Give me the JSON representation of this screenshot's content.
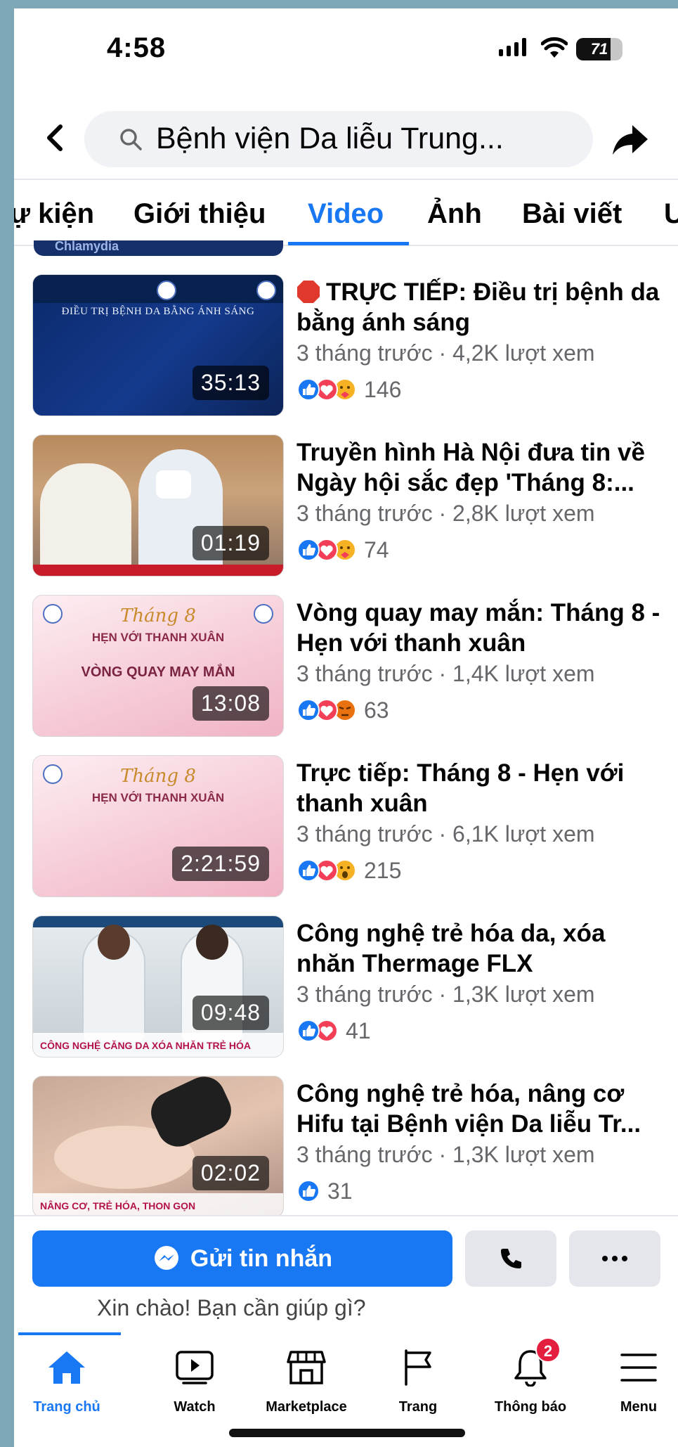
{
  "status_bar": {
    "time": "4:58",
    "battery": "71"
  },
  "search": {
    "query": "Bệnh viện Da liễu Trung..."
  },
  "tabs": [
    {
      "label": "ự kiện"
    },
    {
      "label": "Giới thiệu"
    },
    {
      "label": "Video",
      "active": true
    },
    {
      "label": "Ảnh"
    },
    {
      "label": "Bài viết"
    },
    {
      "label": "U"
    }
  ],
  "peek_label": "Chlamydia",
  "videos": [
    {
      "title": "TRỰC TIẾP: Điều trị bệnh da bằng ánh sáng",
      "live_icon": true,
      "meta": "3 tháng trước · 4,2K lượt xem",
      "reactions": [
        "like",
        "love",
        "care"
      ],
      "count": "146",
      "duration": "35:13",
      "thumb": {
        "caption": "ĐIỀU TRỊ BỆNH DA BẰNG ÁNH SÁNG"
      }
    },
    {
      "title": "Truyền hình Hà Nội đưa tin về Ngày hội sắc đẹp 'Tháng 8:...",
      "meta": "3 tháng trước · 2,8K lượt xem",
      "reactions": [
        "love",
        "care"
      ],
      "count": "74",
      "duration": "01:19"
    },
    {
      "title": "Vòng quay may mắn: Tháng 8 - Hẹn với thanh xuân",
      "meta": "3 tháng trước · 1,4K lượt xem",
      "reactions": [
        "like",
        "love",
        "angry"
      ],
      "count": "63",
      "duration": "13:08",
      "thumb": {
        "script": "Tháng 8",
        "heading": "HẸN VỚI THANH XUÂN",
        "sub": "VÒNG QUAY MAY MẮN"
      }
    },
    {
      "title": "Trực tiếp: Tháng 8 - Hẹn với thanh xuân",
      "meta": "3 tháng trước · 6,1K lượt xem",
      "reactions": [
        "like",
        "love",
        "wow"
      ],
      "count": "215",
      "duration": "2:21:59",
      "thumb": {
        "script": "Tháng 8",
        "heading": "HẸN VỚI THANH XUÂN"
      }
    },
    {
      "title": "Công nghệ trẻ hóa da, xóa nhăn Thermage FLX",
      "meta": "3 tháng trước · 1,3K lượt xem",
      "reactions": [
        "like",
        "love"
      ],
      "count": "41",
      "duration": "09:48",
      "thumb": {
        "sub": "CÔNG NGHỆ CĂNG DA XÓA NHĂN TRẺ HÓA"
      }
    },
    {
      "title": "Công nghệ trẻ hóa, nâng cơ Hifu tại Bệnh viện Da liễu Tr...",
      "meta": "3 tháng trước · 1,3K lượt xem",
      "reactions": [
        "like"
      ],
      "count": "31",
      "duration": "02:02",
      "thumb": {
        "sub": "NÂNG CƠ, TRẺ HÓA, THON GỌN"
      }
    }
  ],
  "actions": {
    "message_label": "Gửi tin nhắn",
    "greeting": "Xin chào! Bạn cần giúp gì?"
  },
  "nav": [
    {
      "label": "Trang chủ",
      "icon": "home-icon",
      "active": true
    },
    {
      "label": "Watch",
      "icon": "watch-icon"
    },
    {
      "label": "Marketplace",
      "icon": "marketplace-icon"
    },
    {
      "label": "Trang",
      "icon": "flag-icon"
    },
    {
      "label": "Thông báo",
      "icon": "bell-icon",
      "badge": "2"
    },
    {
      "label": "Menu",
      "icon": "menu-icon"
    }
  ],
  "colors": {
    "accent": "#1877f2",
    "badge": "#e41e3f"
  }
}
